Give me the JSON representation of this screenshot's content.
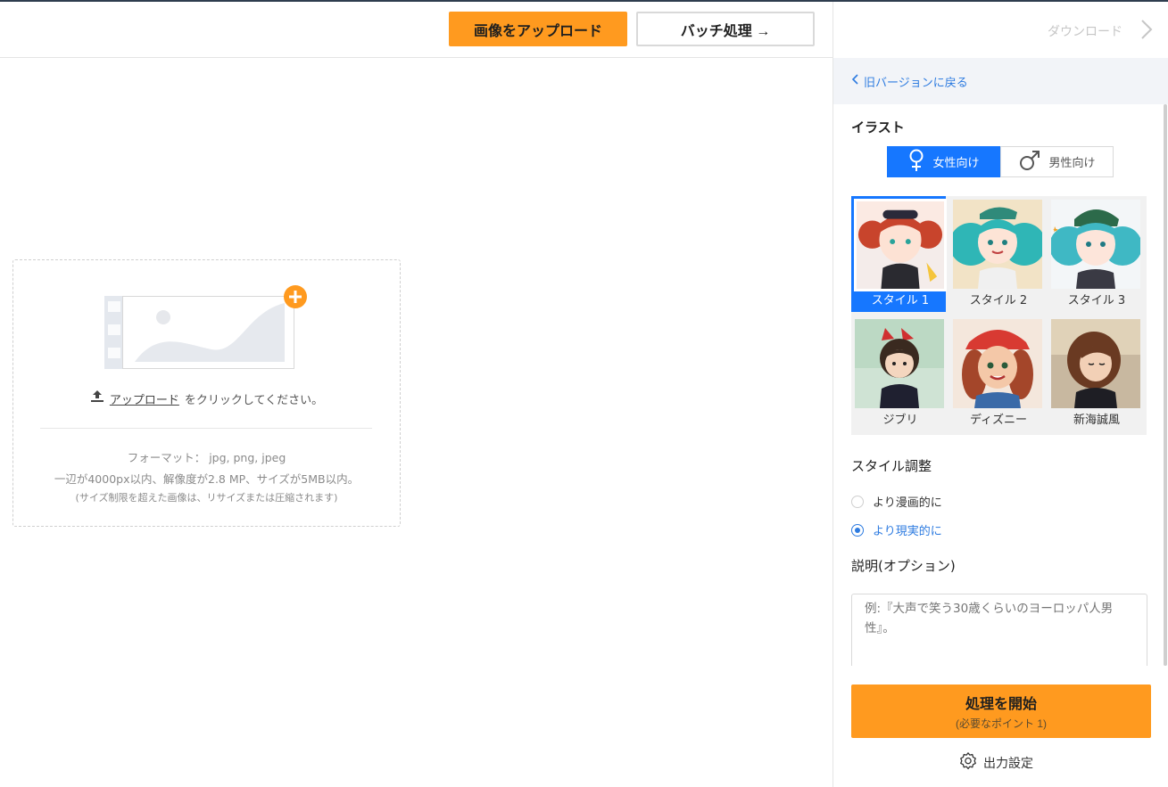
{
  "toolbar": {
    "upload_label": "画像をアップロード",
    "batch_label": "バッチ処理 →"
  },
  "dropzone": {
    "click_link": "アップロード",
    "click_rest": "をクリックしてください。",
    "format": "フォーマット： jpg, png, jpeg",
    "limit": "一辺が4000px以内、解像度が2.8 MP、サイズが5MB以内。",
    "note": "(サイズ制限を超えた画像は、リサイズまたは圧縮されます)"
  },
  "panel": {
    "download_label": "ダウンロード",
    "back_label": "旧バージョンに戻る",
    "section_title": "イラスト",
    "gender": {
      "female": "女性向け",
      "male": "男性向け"
    },
    "styles": [
      {
        "label": "スタイル 1",
        "selected": true
      },
      {
        "label": "スタイル 2",
        "selected": false
      },
      {
        "label": "スタイル 3",
        "selected": false
      },
      {
        "label": "ジブリ",
        "selected": false
      },
      {
        "label": "ディズニー",
        "selected": false
      },
      {
        "label": "新海誠風",
        "selected": false
      }
    ],
    "adjust_title": "スタイル調整",
    "radio_manga": "より漫画的に",
    "radio_real": "より現実的に",
    "radio_selected": "より現実的に",
    "desc_title": "説明(オプション)",
    "desc_placeholder": "例:『大声で笑う30歳くらいのヨーロッパ人男性』。",
    "start_label": "処理を開始",
    "start_sub": "(必要なポイント 1)",
    "output_settings": "出力設定"
  },
  "colors": {
    "accent_orange": "#ff9a1f",
    "accent_blue": "#1677ff",
    "link_blue": "#2d7be0"
  }
}
